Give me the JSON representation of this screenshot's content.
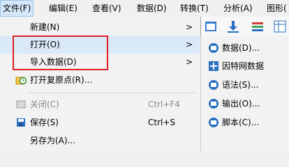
{
  "menubar": {
    "items": [
      {
        "label": "文件(F)"
      },
      {
        "label": "编辑(E)"
      },
      {
        "label": "查看(V)"
      },
      {
        "label": "数据(D)"
      },
      {
        "label": "转换(T)"
      },
      {
        "label": "分析(A)"
      },
      {
        "label": "图形("
      }
    ]
  },
  "file_menu": {
    "new_label": "新建(N)",
    "open_label": "打开(O)",
    "import_label": "导入数据(D)",
    "restore_label": "打开复原点(R)...",
    "close_label": "关闭(C)",
    "close_shortcut": "Ctrl+F4",
    "save_label": "保存(S)",
    "save_shortcut": "Ctrl+S",
    "save_as_label": "另存为(A)..."
  },
  "open_submenu": {
    "data_label": "数据(D)...",
    "internet_label": "因特网数据",
    "syntax_label": "语法(S)...",
    "output_label": "输出(O)...",
    "script_label": "脚本(C)..."
  },
  "colors": {
    "highlight_box": "#e01f25",
    "menu_highlight": "#d9e9f8",
    "icon_blue": "#2b6fc1"
  }
}
